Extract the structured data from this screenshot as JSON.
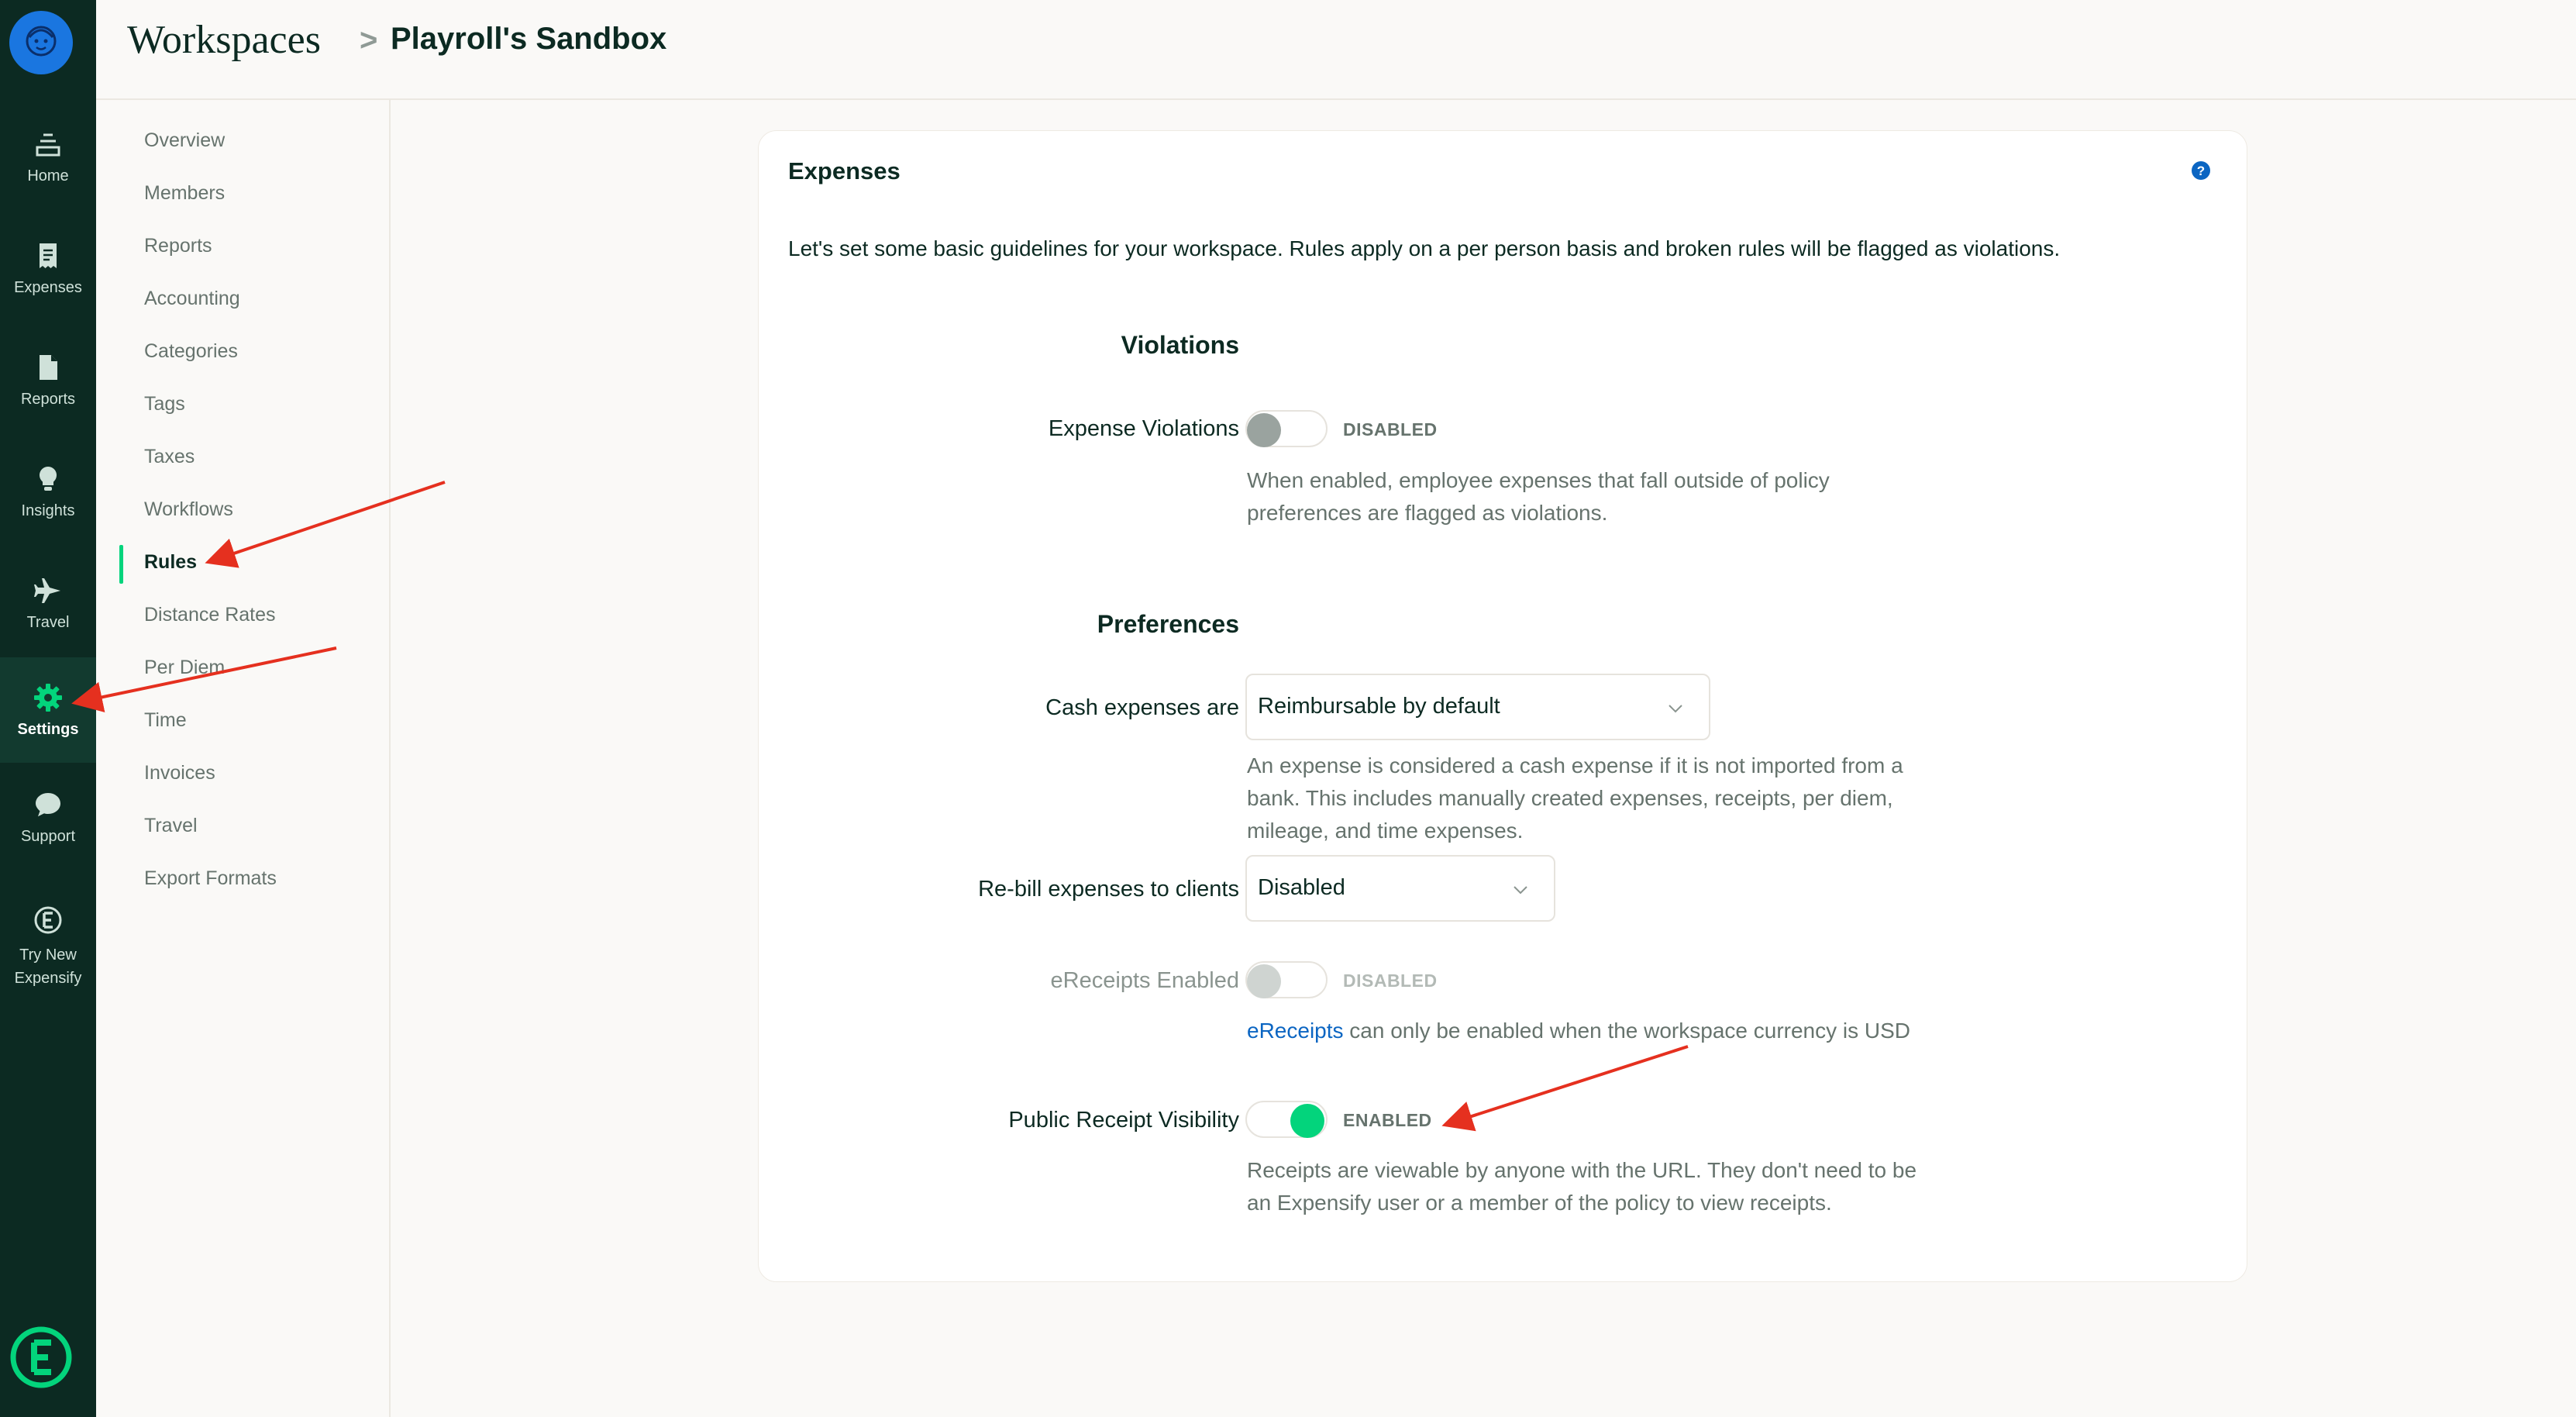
{
  "header": {
    "breadcrumb_root": "Workspaces",
    "breadcrumb_separator": ">",
    "breadcrumb_current": "Playroll's Sandbox"
  },
  "rail": {
    "items": [
      {
        "label": "Home",
        "icon": "inbox-icon"
      },
      {
        "label": "Expenses",
        "icon": "receipt-icon"
      },
      {
        "label": "Reports",
        "icon": "document-icon"
      },
      {
        "label": "Insights",
        "icon": "lightbulb-icon"
      },
      {
        "label": "Travel",
        "icon": "plane-icon"
      },
      {
        "label": "Settings",
        "icon": "gear-icon",
        "active": true
      },
      {
        "label": "Support",
        "icon": "chat-bubble-icon"
      },
      {
        "label": "Try New Expensify",
        "icon": "expensify-e-icon"
      }
    ]
  },
  "submenu": {
    "items": [
      {
        "label": "Overview"
      },
      {
        "label": "Members"
      },
      {
        "label": "Reports"
      },
      {
        "label": "Accounting"
      },
      {
        "label": "Categories"
      },
      {
        "label": "Tags"
      },
      {
        "label": "Taxes"
      },
      {
        "label": "Workflows"
      },
      {
        "label": "Rules",
        "active": true
      },
      {
        "label": "Distance Rates"
      },
      {
        "label": "Per Diem"
      },
      {
        "label": "Time"
      },
      {
        "label": "Invoices"
      },
      {
        "label": "Travel"
      },
      {
        "label": "Export Formats"
      }
    ]
  },
  "card": {
    "title": "Expenses",
    "intro": "Let's set some basic guidelines for your workspace. Rules apply on a per person basis and broken rules will be flagged as violations.",
    "violations": {
      "section_title": "Violations",
      "expense_violations": {
        "label": "Expense Violations",
        "state": "DISABLED",
        "description": "When enabled, employee expenses that fall outside of policy preferences are flagged as violations."
      }
    },
    "preferences": {
      "section_title": "Preferences",
      "cash_expenses": {
        "label": "Cash expenses are",
        "value": "Reimbursable by default",
        "description": "An expense is considered a cash expense if it is not imported from a bank. This includes manually created expenses, receipts, per diem, mileage, and time expenses."
      },
      "rebill": {
        "label": "Re-bill expenses to clients",
        "value": "Disabled"
      },
      "ereceipts": {
        "label": "eReceipts Enabled",
        "state": "DISABLED",
        "description_link": "eReceipts",
        "description_rest": " can only be enabled when the workspace currency is USD"
      },
      "public_receipt": {
        "label": "Public Receipt Visibility",
        "state": "ENABLED",
        "description": "Receipts are viewable by anyone with the URL. They don't need to be an Expensify user or a member of the policy to view receipts."
      }
    }
  },
  "colors": {
    "rail_bg": "#0c2a22",
    "accent_green": "#03d47c",
    "link_blue": "#0b65c2",
    "annotation_red": "#e5301f"
  }
}
